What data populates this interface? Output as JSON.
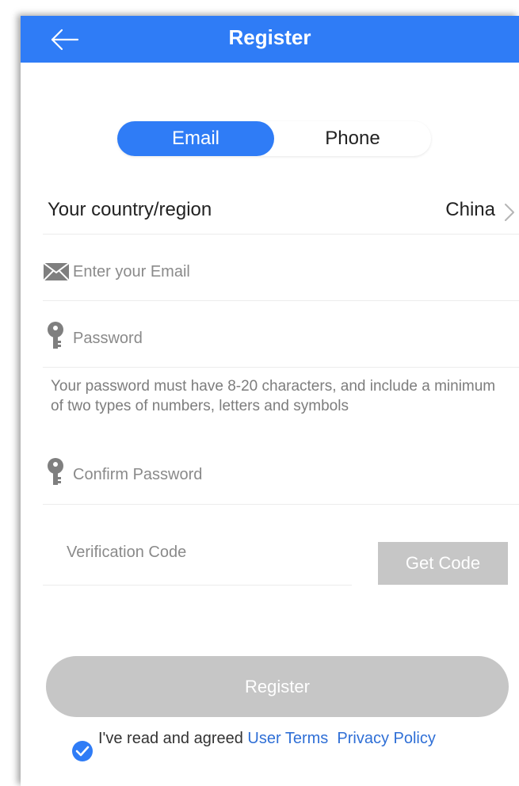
{
  "header": {
    "title": "Register",
    "back_icon": "arrow-left-icon",
    "color": "#2f7cf6"
  },
  "tabs": {
    "email_label": "Email",
    "phone_label": "Phone",
    "selected": "Email"
  },
  "country": {
    "label": "Your country/region",
    "value": "China",
    "chevron_icon": "chevron-right-icon"
  },
  "email": {
    "placeholder": "Enter your Email",
    "icon": "envelope-icon"
  },
  "password": {
    "placeholder": "Password",
    "icon": "key-icon",
    "hint": "Your password must have 8-20 characters, and include a minimum of two types of numbers, letters and symbols"
  },
  "confirm_password": {
    "placeholder": "Confirm Password",
    "icon": "key-icon"
  },
  "verification": {
    "placeholder": "Verification Code",
    "button_label": "Get Code"
  },
  "register_button": {
    "label": "Register"
  },
  "agreement": {
    "prefix": "I've read and agreed",
    "user_terms": "User Terms",
    "privacy": "Privacy Policy",
    "checked": true,
    "check_icon": "check-circle-icon"
  },
  "colors": {
    "accent": "#2f7cf6",
    "disabled": "#c6c6c6",
    "link": "#2f6fd6"
  }
}
